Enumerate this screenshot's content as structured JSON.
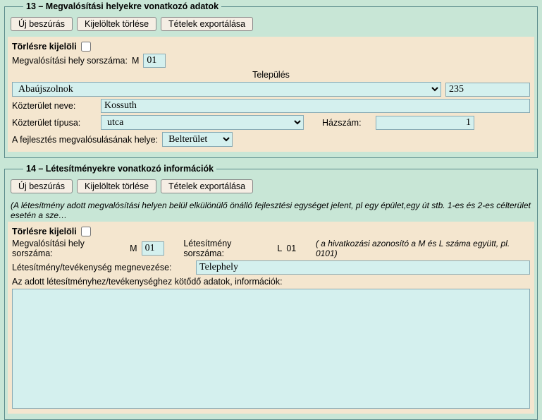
{
  "section13": {
    "legend": "13 – Megvalósítási helyekre vonatkozó adatok",
    "buttons": {
      "new": "Új beszúrás",
      "delete": "Kijelöltek törlése",
      "export": "Tételek exportálása"
    },
    "del_label": "Törlésre kijelöli",
    "seq_label": "Megvalósítási hely sorszáma:",
    "seq_prefix": "M",
    "seq_value": "01",
    "settlement_label": "Település",
    "settlement_value": "Abaújszolnok",
    "settlement_code": "235",
    "street_name_label": "Közterület neve:",
    "street_name_value": "Kossuth",
    "street_type_label": "Közterület típusa:",
    "street_type_value": "utca",
    "house_no_label": "Házszám:",
    "house_no_value": "1",
    "dev_place_label": "A fejlesztés megvalósulásának helye:",
    "dev_place_value": "Belterület"
  },
  "section14": {
    "legend": "14 – Létesítményekre vonatkozó információk",
    "buttons": {
      "new": "Új beszúrás",
      "delete": "Kijelöltek törlése",
      "export": "Tételek exportálása"
    },
    "note": "(A létesítmény adott megvalósítási helyen belül elkülönülő önálló fejlesztési egységet jelent, pl egy épület,egy út stb. 1-es és 2-es célterület esetén a sze…",
    "del_label": "Törlésre kijelöli",
    "seq_m_label": "Megvalósítási hely sorszáma:",
    "seq_m_prefix": "M",
    "seq_m_value": "01",
    "seq_l_label": "Létesítmény sorszáma:",
    "seq_l_prefix": "L",
    "seq_l_value": "01",
    "ref_note": "( a hivatkozási azonosító a M és L száma együtt, pl. 0101)",
    "name_label": "Létesítmény/tevékenység megnevezése:",
    "name_value": "Telephely",
    "info_label": "Az adott létesítményhez/tevékenységhez kötődő adatok, információk:",
    "info_value": ""
  }
}
